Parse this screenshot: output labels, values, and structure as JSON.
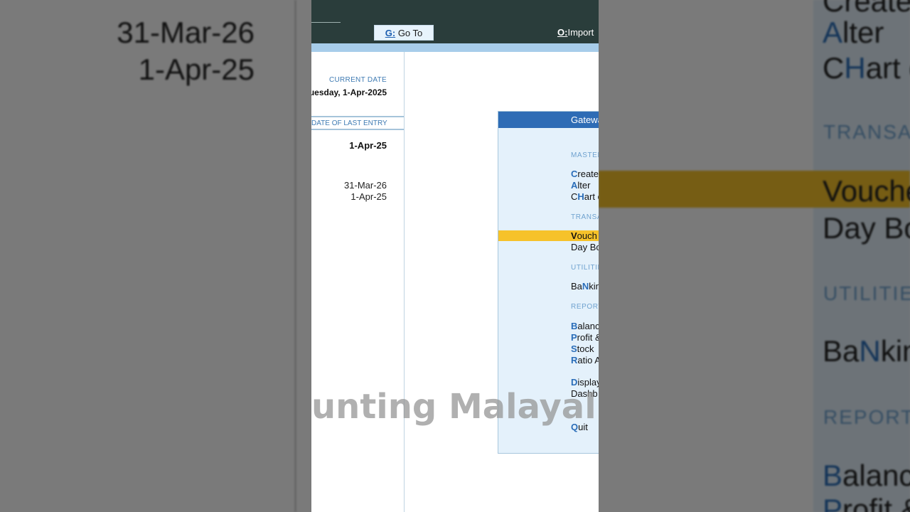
{
  "toolbar": {
    "goto_key": "G:",
    "goto_label": "Go To",
    "import_key": "O:",
    "import_label": "Import"
  },
  "info": {
    "current_date_label": "CURRENT DATE",
    "current_date_value": "uesday, 1-Apr-2025",
    "last_entry_label": "DATE OF LAST ENTRY",
    "last_entry_value": "1-Apr-25",
    "period_to": "31-Mar-26",
    "period_from": "1-Apr-25"
  },
  "gateway": {
    "title": "Gatewa",
    "sections": {
      "masters": "MASTER",
      "transactions": "TRANSA",
      "utilities": "UTILITIE",
      "reports": "REPORT"
    },
    "items": {
      "create": {
        "key": "C",
        "rest": "reate"
      },
      "alter": {
        "key": "A",
        "rest": "lter"
      },
      "chart": {
        "pre": "C",
        "key": "H",
        "rest": "art o"
      },
      "vouchers": {
        "key": "V",
        "rest": "ouch"
      },
      "daybook": {
        "pre": "Day Bo"
      },
      "banking": {
        "pre": "Ba",
        "key": "N",
        "rest": "kin"
      },
      "balance": {
        "key": "B",
        "rest": "alanc"
      },
      "profit": {
        "key": "P",
        "rest": "rofit &"
      },
      "stock": {
        "key": "S",
        "rest": "tock"
      },
      "ratio": {
        "key": "R",
        "rest": "atio A"
      },
      "display": {
        "key": "D",
        "rest": "isplay"
      },
      "dashboard": {
        "pre": "Dashb"
      },
      "quit": {
        "key": "Q",
        "rest": "uit"
      }
    }
  },
  "watermark": "unting Malayal",
  "background_left": {
    "date_to": "31-Mar-26",
    "date_from": "1-Apr-25"
  },
  "background_right": {
    "create": "Create",
    "alter_key": "A",
    "alter_rest": "lter",
    "chart_pre": "C",
    "chart_key": "H",
    "chart_rest": "art o",
    "transactions": "TRANSA",
    "vouchers_key": "V",
    "vouchers_rest": "ouche",
    "daybook": "Day Bo",
    "utilities": "UTILITIE",
    "banking_pre": "Ba",
    "banking_key": "N",
    "banking_rest": "kin",
    "reports": "REPORT",
    "balance_key": "B",
    "balance_rest": "alanc",
    "profit_key": "P",
    "profit_rest": "rofit  &"
  },
  "colors": {
    "topbar": "#2a3d3b",
    "accent_blue": "#2e6cb5",
    "highlight": "#f6c22a",
    "panel_bg": "#e4f1fb"
  }
}
